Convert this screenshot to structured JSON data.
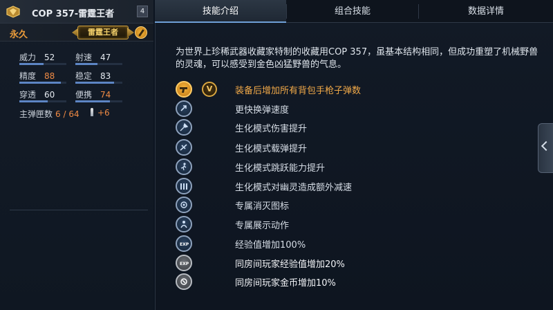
{
  "weapon": {
    "name": "COP 357-雷霆王者",
    "level": "4",
    "durability": "永久",
    "badge_text": "雷霆王者"
  },
  "stats": [
    {
      "label": "威力",
      "value": "52",
      "highlight": false,
      "fill": 0.52
    },
    {
      "label": "射速",
      "value": "47",
      "highlight": false,
      "fill": 0.47
    },
    {
      "label": "精度",
      "value": "88",
      "highlight": true,
      "fill": 0.88
    },
    {
      "label": "稳定",
      "value": "83",
      "highlight": false,
      "fill": 0.83
    },
    {
      "label": "穿透",
      "value": "60",
      "highlight": false,
      "fill": 0.6
    },
    {
      "label": "便携",
      "value": "74",
      "highlight": true,
      "fill": 0.74
    }
  ],
  "magazine": {
    "label": "主弹匣数",
    "value": "6 / 64",
    "bonus": "+6"
  },
  "tabs": [
    {
      "label": "技能介绍",
      "active": true
    },
    {
      "label": "组合技能",
      "active": false
    },
    {
      "label": "数据详情",
      "active": false
    }
  ],
  "description": "为世界上珍稀武器收藏家特制的收藏用COP 357，虽基本结构相同，但成功重塑了机械野兽的灵魂，可以感受到金色凶猛野兽的气息。",
  "v_badge": "V",
  "skills": [
    {
      "label": "装备后增加所有背包手枪子弹数",
      "icon": "pistol-icon",
      "style": "gold",
      "text_style": "highlight"
    },
    {
      "label": "更快换弹速度",
      "icon": "reload-icon",
      "style": "blue",
      "text_style": "normal"
    },
    {
      "label": "生化模式伤害提升",
      "icon": "damage-icon",
      "style": "blue",
      "text_style": "normal"
    },
    {
      "label": "生化模式载弹提升",
      "icon": "ammo-capacity-icon",
      "style": "blue",
      "text_style": "normal"
    },
    {
      "label": "生化模式跳跃能力提升",
      "icon": "jump-icon",
      "style": "blue",
      "text_style": "normal"
    },
    {
      "label": "生化模式对幽灵造成额外减速",
      "icon": "slow-icon",
      "style": "blue",
      "text_style": "normal"
    },
    {
      "label": "专属消灭图标",
      "icon": "kill-mark-icon",
      "style": "blue",
      "text_style": "normal"
    },
    {
      "label": "专属展示动作",
      "icon": "showcase-icon",
      "style": "blue",
      "text_style": "normal"
    },
    {
      "label": "经验值增加100%",
      "icon": "exp-icon",
      "style": "blue",
      "text_style": "normal"
    },
    {
      "label": "同房间玩家经验值增加20%",
      "icon": "room-exp-icon",
      "style": "grey",
      "text_style": "white"
    },
    {
      "label": "同房间玩家金币增加10%",
      "icon": "room-gold-icon",
      "style": "grey",
      "text_style": "white"
    }
  ]
}
